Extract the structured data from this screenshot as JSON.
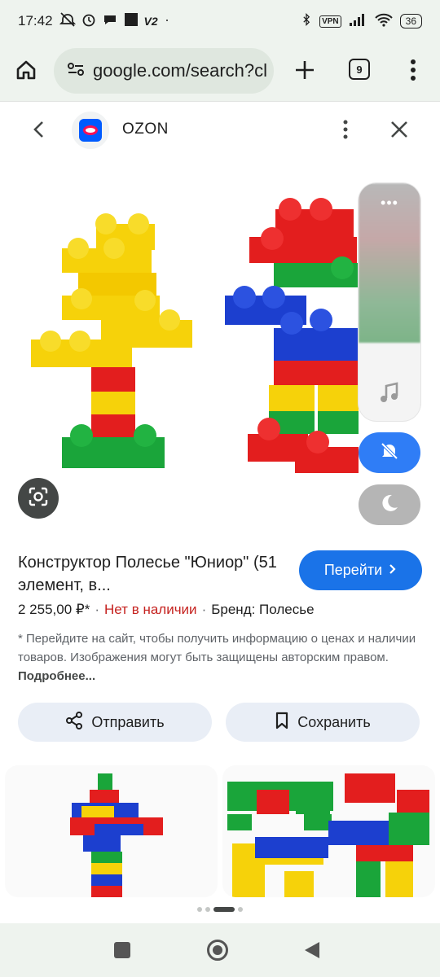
{
  "status_bar": {
    "time": "17:42",
    "extra_label": "V2",
    "vpn_label": "VPN",
    "battery": "36"
  },
  "browser": {
    "url": "google.com/search?cl",
    "tab_count": "9"
  },
  "source": {
    "name": "OZON"
  },
  "product": {
    "title": "Конструктор Полесье \"Юниор\" (51 элемент, в...",
    "goto_label": "Перейти",
    "price": "2 255,00 ₽*",
    "availability": "Нет в наличии",
    "brand": "Бренд: Полесье",
    "notice_text": "* Перейдите на сайт, чтобы получить информацию о ценах и наличии товаров. Изображения могут быть защищены авторским правом.",
    "notice_more": "Подробнее..."
  },
  "actions": {
    "share_label": "Отправить",
    "save_label": "Сохранить"
  },
  "floating_panel": {
    "dots": "•••"
  },
  "pager": {
    "pages": 4,
    "active_index": 2
  },
  "colors": {
    "accent": "#1a73e8",
    "out_of_stock": "#c5221f",
    "browser_chrome": "#eef3ee",
    "dnd_blue": "#2f7df6"
  }
}
